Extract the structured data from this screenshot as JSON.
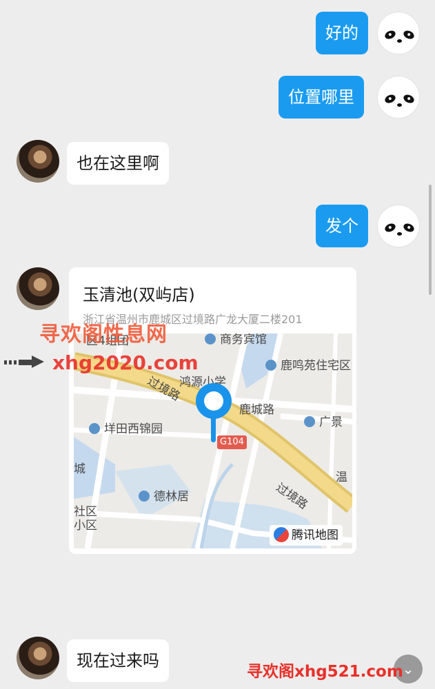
{
  "messages": {
    "m1": "好的",
    "m2": "位置哪里",
    "m3": "也在这里啊",
    "m4": "发个",
    "m5": "现在过来吗"
  },
  "location": {
    "name": "玉清池(双屿店)",
    "address": "浙江省温州市鹿城区过境路广龙大厦二楼201",
    "map_labels": {
      "shangwu": "商务宾馆",
      "quyin": "区4组团",
      "luming": "鹿鸣苑住宅区",
      "hongyuan": "鸿源小学",
      "guojinglu1": "过境路",
      "luchenglu": "鹿城路",
      "tiantian": "垟田西锦园",
      "guangjing": "广景",
      "g104": "G104",
      "delin": "德林居",
      "wen": "温",
      "guojinglu2": "过境路",
      "shequ": "社区",
      "xiaoqu": "小区",
      "cheng": "城"
    },
    "provider": "腾讯地图"
  },
  "watermarks": {
    "top": "寻欢阁性息网",
    "mid": "xhg2020.com",
    "bottom": "寻欢阁xhg521.com"
  },
  "icons": {
    "panda_avatar": "panda-face-icon",
    "user_avatar": "user-photo-avatar",
    "pin": "location-pin-icon",
    "scroll_down": "chevron-down-icon"
  },
  "colors": {
    "outgoing_bubble": "#1a9bf0",
    "incoming_bubble": "#ffffff",
    "background": "#ededed",
    "map_pin": "#1a93ea"
  }
}
